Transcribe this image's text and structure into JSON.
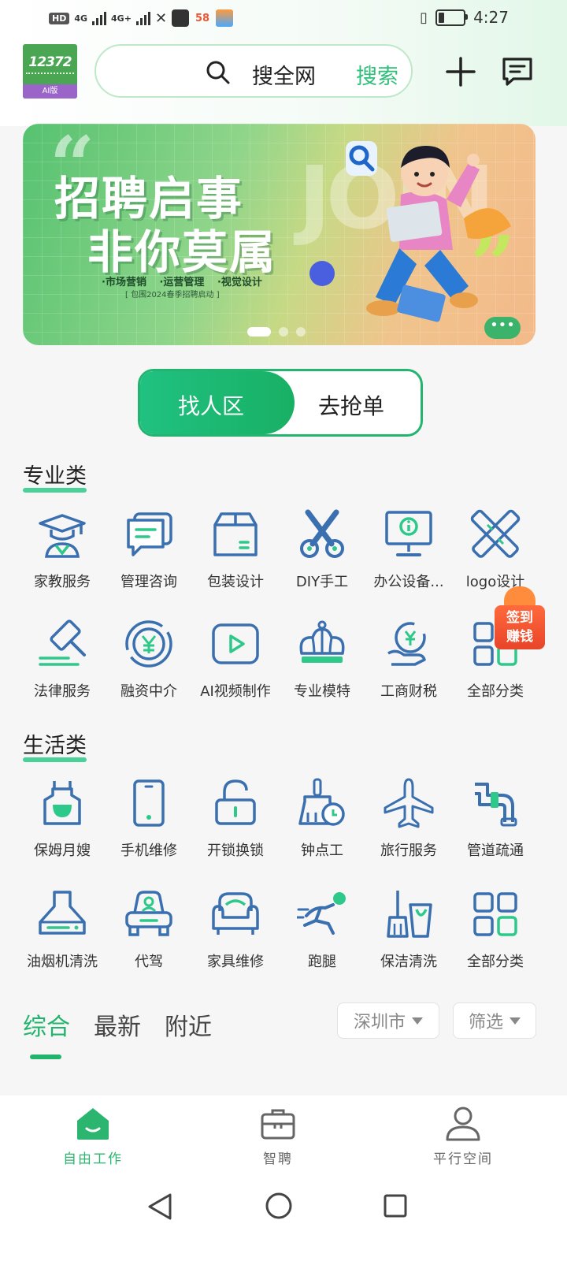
{
  "status_bar": {
    "hd": "HD",
    "sim1": "4G",
    "sim2": "4G+",
    "app58": "58",
    "time": "4:27"
  },
  "header": {
    "logo_text": "12372",
    "logo_sub": "AI版",
    "search_placeholder": "搜全网",
    "search_button": "搜索"
  },
  "banner": {
    "line1": "招聘启事",
    "line2": "非你莫属",
    "tags": [
      "·市场营销",
      "·运营管理",
      "·视觉设计"
    ],
    "small": "[ 包围2024春季招聘启动 ]",
    "decor_text": "JOIN"
  },
  "toggle": {
    "left": "找人区",
    "right": "去抢单"
  },
  "professional": {
    "title": "专业类",
    "items": [
      {
        "label": "家教服务"
      },
      {
        "label": "管理咨询"
      },
      {
        "label": "包装设计"
      },
      {
        "label": "DIY手工"
      },
      {
        "label": "办公设备..."
      },
      {
        "label": "logo设计"
      },
      {
        "label": "法律服务"
      },
      {
        "label": "融资中介"
      },
      {
        "label": "AI视频制作"
      },
      {
        "label": "专业模特"
      },
      {
        "label": "工商财税"
      },
      {
        "label": "全部分类"
      }
    ]
  },
  "life": {
    "title": "生活类",
    "items": [
      {
        "label": "保姆月嫂"
      },
      {
        "label": "手机维修"
      },
      {
        "label": "开锁换锁"
      },
      {
        "label": "钟点工"
      },
      {
        "label": "旅行服务"
      },
      {
        "label": "管道疏通"
      },
      {
        "label": "油烟机清洗"
      },
      {
        "label": "代驾"
      },
      {
        "label": "家具维修"
      },
      {
        "label": "跑腿"
      },
      {
        "label": "保洁清洗"
      },
      {
        "label": "全部分类"
      }
    ]
  },
  "sign_badge": {
    "line1": "签到",
    "line2": "赚钱"
  },
  "feed_tabs": [
    "综合",
    "最新",
    "附近"
  ],
  "filters": {
    "city": "深圳市",
    "filter": "筛选"
  },
  "bottom_nav": [
    {
      "label": "自由工作",
      "icon": "home-icon"
    },
    {
      "label": "智聘",
      "icon": "briefcase-icon"
    },
    {
      "label": "平行空间",
      "icon": "person-icon"
    }
  ],
  "colors": {
    "accent": "#20b46c",
    "icon_blue": "#3a6fb0",
    "icon_green": "#2dc98a"
  }
}
